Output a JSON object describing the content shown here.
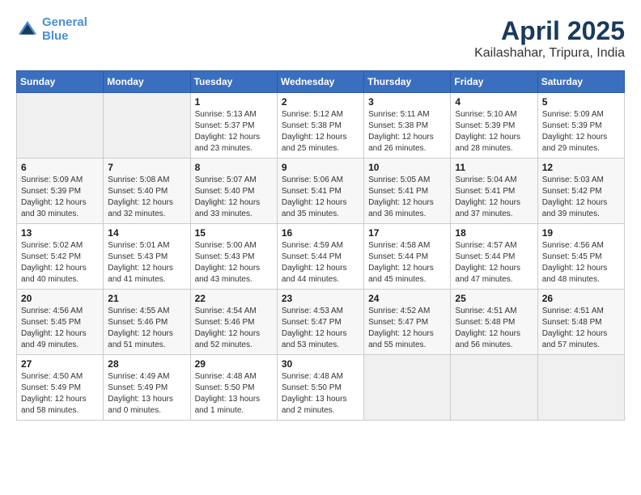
{
  "app": {
    "name": "GeneralBlue",
    "logo_line1": "General",
    "logo_line2": "Blue"
  },
  "calendar": {
    "title": "April 2025",
    "location": "Kailashahar, Tripura, India",
    "headers": [
      "Sunday",
      "Monday",
      "Tuesday",
      "Wednesday",
      "Thursday",
      "Friday",
      "Saturday"
    ],
    "rows": [
      [
        {
          "day": "",
          "detail": ""
        },
        {
          "day": "",
          "detail": ""
        },
        {
          "day": "1",
          "detail": "Sunrise: 5:13 AM\nSunset: 5:37 PM\nDaylight: 12 hours\nand 23 minutes."
        },
        {
          "day": "2",
          "detail": "Sunrise: 5:12 AM\nSunset: 5:38 PM\nDaylight: 12 hours\nand 25 minutes."
        },
        {
          "day": "3",
          "detail": "Sunrise: 5:11 AM\nSunset: 5:38 PM\nDaylight: 12 hours\nand 26 minutes."
        },
        {
          "day": "4",
          "detail": "Sunrise: 5:10 AM\nSunset: 5:39 PM\nDaylight: 12 hours\nand 28 minutes."
        },
        {
          "day": "5",
          "detail": "Sunrise: 5:09 AM\nSunset: 5:39 PM\nDaylight: 12 hours\nand 29 minutes."
        }
      ],
      [
        {
          "day": "6",
          "detail": "Sunrise: 5:09 AM\nSunset: 5:39 PM\nDaylight: 12 hours\nand 30 minutes."
        },
        {
          "day": "7",
          "detail": "Sunrise: 5:08 AM\nSunset: 5:40 PM\nDaylight: 12 hours\nand 32 minutes."
        },
        {
          "day": "8",
          "detail": "Sunrise: 5:07 AM\nSunset: 5:40 PM\nDaylight: 12 hours\nand 33 minutes."
        },
        {
          "day": "9",
          "detail": "Sunrise: 5:06 AM\nSunset: 5:41 PM\nDaylight: 12 hours\nand 35 minutes."
        },
        {
          "day": "10",
          "detail": "Sunrise: 5:05 AM\nSunset: 5:41 PM\nDaylight: 12 hours\nand 36 minutes."
        },
        {
          "day": "11",
          "detail": "Sunrise: 5:04 AM\nSunset: 5:41 PM\nDaylight: 12 hours\nand 37 minutes."
        },
        {
          "day": "12",
          "detail": "Sunrise: 5:03 AM\nSunset: 5:42 PM\nDaylight: 12 hours\nand 39 minutes."
        }
      ],
      [
        {
          "day": "13",
          "detail": "Sunrise: 5:02 AM\nSunset: 5:42 PM\nDaylight: 12 hours\nand 40 minutes."
        },
        {
          "day": "14",
          "detail": "Sunrise: 5:01 AM\nSunset: 5:43 PM\nDaylight: 12 hours\nand 41 minutes."
        },
        {
          "day": "15",
          "detail": "Sunrise: 5:00 AM\nSunset: 5:43 PM\nDaylight: 12 hours\nand 43 minutes."
        },
        {
          "day": "16",
          "detail": "Sunrise: 4:59 AM\nSunset: 5:44 PM\nDaylight: 12 hours\nand 44 minutes."
        },
        {
          "day": "17",
          "detail": "Sunrise: 4:58 AM\nSunset: 5:44 PM\nDaylight: 12 hours\nand 45 minutes."
        },
        {
          "day": "18",
          "detail": "Sunrise: 4:57 AM\nSunset: 5:44 PM\nDaylight: 12 hours\nand 47 minutes."
        },
        {
          "day": "19",
          "detail": "Sunrise: 4:56 AM\nSunset: 5:45 PM\nDaylight: 12 hours\nand 48 minutes."
        }
      ],
      [
        {
          "day": "20",
          "detail": "Sunrise: 4:56 AM\nSunset: 5:45 PM\nDaylight: 12 hours\nand 49 minutes."
        },
        {
          "day": "21",
          "detail": "Sunrise: 4:55 AM\nSunset: 5:46 PM\nDaylight: 12 hours\nand 51 minutes."
        },
        {
          "day": "22",
          "detail": "Sunrise: 4:54 AM\nSunset: 5:46 PM\nDaylight: 12 hours\nand 52 minutes."
        },
        {
          "day": "23",
          "detail": "Sunrise: 4:53 AM\nSunset: 5:47 PM\nDaylight: 12 hours\nand 53 minutes."
        },
        {
          "day": "24",
          "detail": "Sunrise: 4:52 AM\nSunset: 5:47 PM\nDaylight: 12 hours\nand 55 minutes."
        },
        {
          "day": "25",
          "detail": "Sunrise: 4:51 AM\nSunset: 5:48 PM\nDaylight: 12 hours\nand 56 minutes."
        },
        {
          "day": "26",
          "detail": "Sunrise: 4:51 AM\nSunset: 5:48 PM\nDaylight: 12 hours\nand 57 minutes."
        }
      ],
      [
        {
          "day": "27",
          "detail": "Sunrise: 4:50 AM\nSunset: 5:49 PM\nDaylight: 12 hours\nand 58 minutes."
        },
        {
          "day": "28",
          "detail": "Sunrise: 4:49 AM\nSunset: 5:49 PM\nDaylight: 13 hours\nand 0 minutes."
        },
        {
          "day": "29",
          "detail": "Sunrise: 4:48 AM\nSunset: 5:50 PM\nDaylight: 13 hours\nand 1 minute."
        },
        {
          "day": "30",
          "detail": "Sunrise: 4:48 AM\nSunset: 5:50 PM\nDaylight: 13 hours\nand 2 minutes."
        },
        {
          "day": "",
          "detail": ""
        },
        {
          "day": "",
          "detail": ""
        },
        {
          "day": "",
          "detail": ""
        }
      ]
    ]
  }
}
